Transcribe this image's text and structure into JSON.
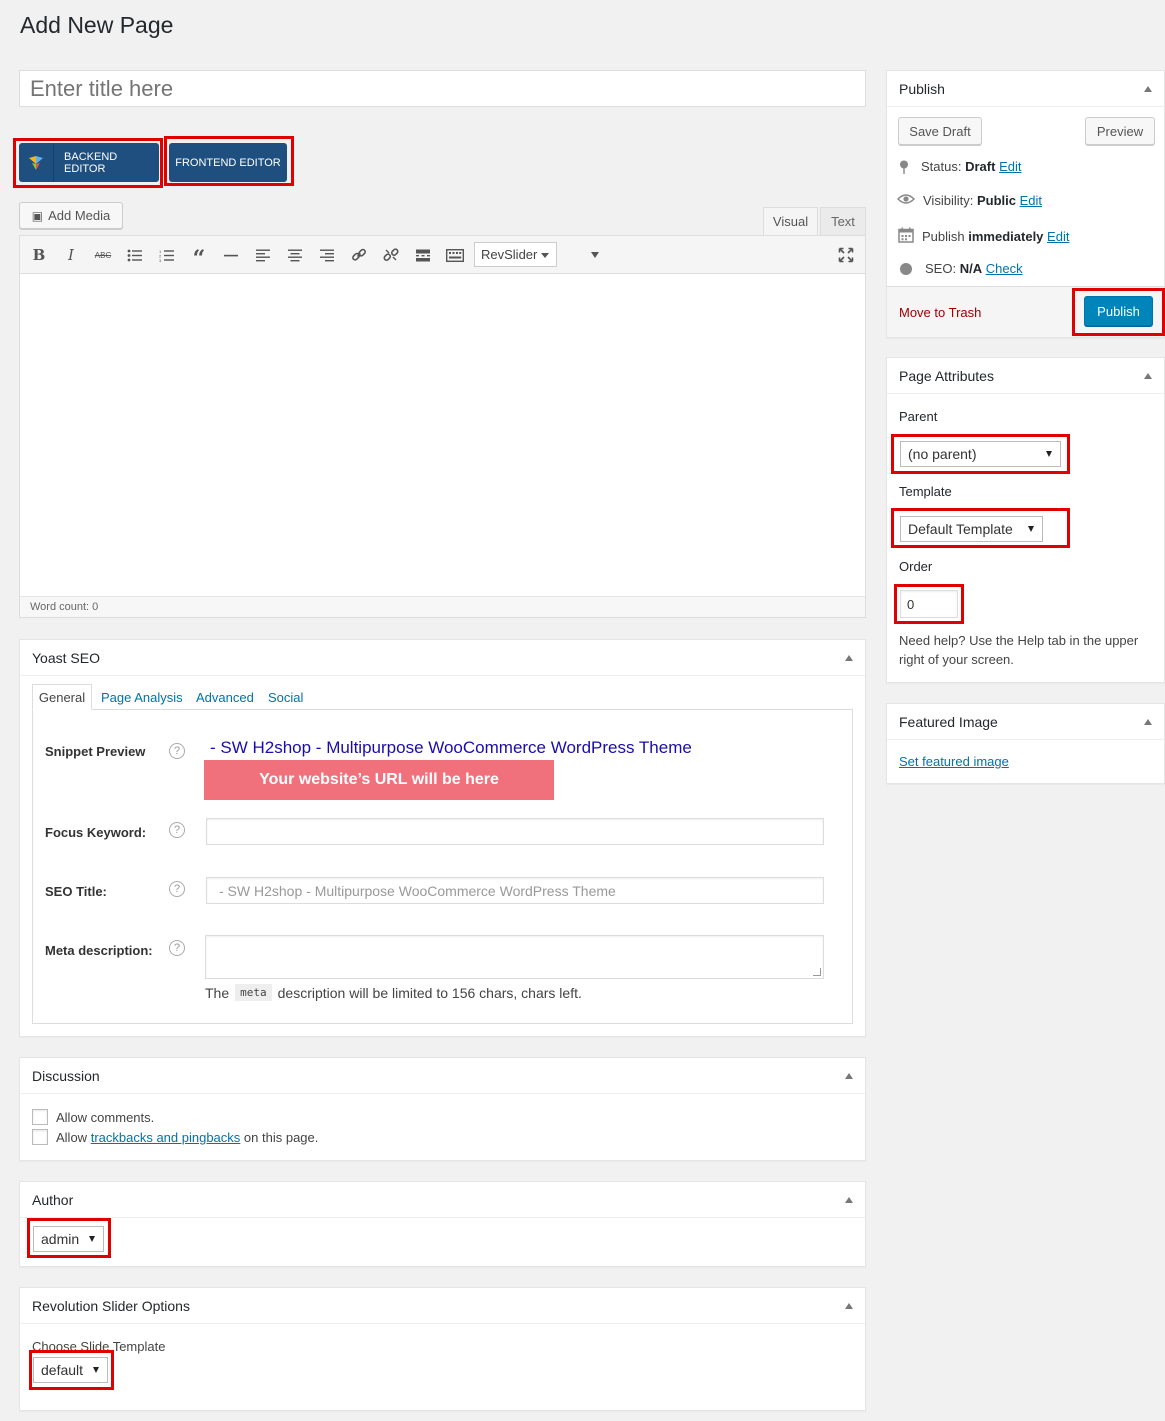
{
  "page": {
    "title": "Add New Page"
  },
  "title_input": {
    "placeholder": "Enter title here"
  },
  "composer": {
    "backend_label": "BACKEND EDITOR",
    "frontend_label": "FRONTEND EDITOR"
  },
  "editor": {
    "add_media": "Add Media",
    "tab_visual": "Visual",
    "tab_text": "Text",
    "revslider": "RevSlider",
    "word_count": "Word count: 0",
    "toolbar_icons": [
      "bold-icon",
      "italic-icon",
      "strikethrough-icon",
      "bullet-list-icon",
      "numbered-list-icon",
      "blockquote-icon",
      "horizontal-line-icon",
      "align-left-icon",
      "align-center-icon",
      "align-right-icon",
      "link-icon",
      "unlink-icon",
      "read-more-icon",
      "toolbar-toggle-icon",
      "fullscreen-icon"
    ]
  },
  "publish": {
    "title": "Publish",
    "save_draft": "Save Draft",
    "preview": "Preview",
    "status_label": "Status:",
    "status_value": "Draft",
    "visibility_label": "Visibility:",
    "visibility_value": "Public",
    "publish_label": "Publish",
    "publish_value": "immediately",
    "seo_label": "SEO:",
    "seo_value": "N/A",
    "edit": "Edit",
    "check": "Check",
    "move_to_trash": "Move to Trash",
    "publish_button": "Publish"
  },
  "attributes": {
    "title": "Page Attributes",
    "parent_label": "Parent",
    "parent_value": "(no parent)",
    "template_label": "Template",
    "template_value": "Default Template",
    "order_label": "Order",
    "order_value": "0",
    "help": "Need help? Use the Help tab in the upper right of your screen."
  },
  "featured": {
    "title": "Featured Image",
    "set_link": "Set featured image"
  },
  "yoast": {
    "title": "Yoast SEO",
    "tabs": [
      "General",
      "Page Analysis",
      "Advanced",
      "Social"
    ],
    "snippet_label": "Snippet Preview",
    "snippet_title": "- SW H2shop - Multipurpose WooCommerce WordPress Theme",
    "snippet_url": "Your website’s URL will be here",
    "focus_label": "Focus Keyword:",
    "seo_title_label": "SEO Title:",
    "seo_title_placeholder": "- SW H2shop - Multipurpose WooCommerce WordPress Theme",
    "meta_label": "Meta description:",
    "meta_note_before": "The",
    "meta_note_code": "meta",
    "meta_note_after": "description will be limited to 156 chars, chars left."
  },
  "discussion": {
    "title": "Discussion",
    "allow_comments": "Allow comments.",
    "allow_prefix": "Allow",
    "trackbacks_link": "trackbacks and pingbacks",
    "allow_suffix": "on this page."
  },
  "author": {
    "title": "Author",
    "value": "admin"
  },
  "revslider": {
    "title": "Revolution Slider Options",
    "choose_label": "Choose Slide Template",
    "value": "default"
  },
  "colors": {
    "primary_button": "#0085ba",
    "composer_button": "#1f4f7f",
    "snippet_url_bg": "#f0707c",
    "highlight": "#e00000",
    "trash": "#a00000"
  }
}
